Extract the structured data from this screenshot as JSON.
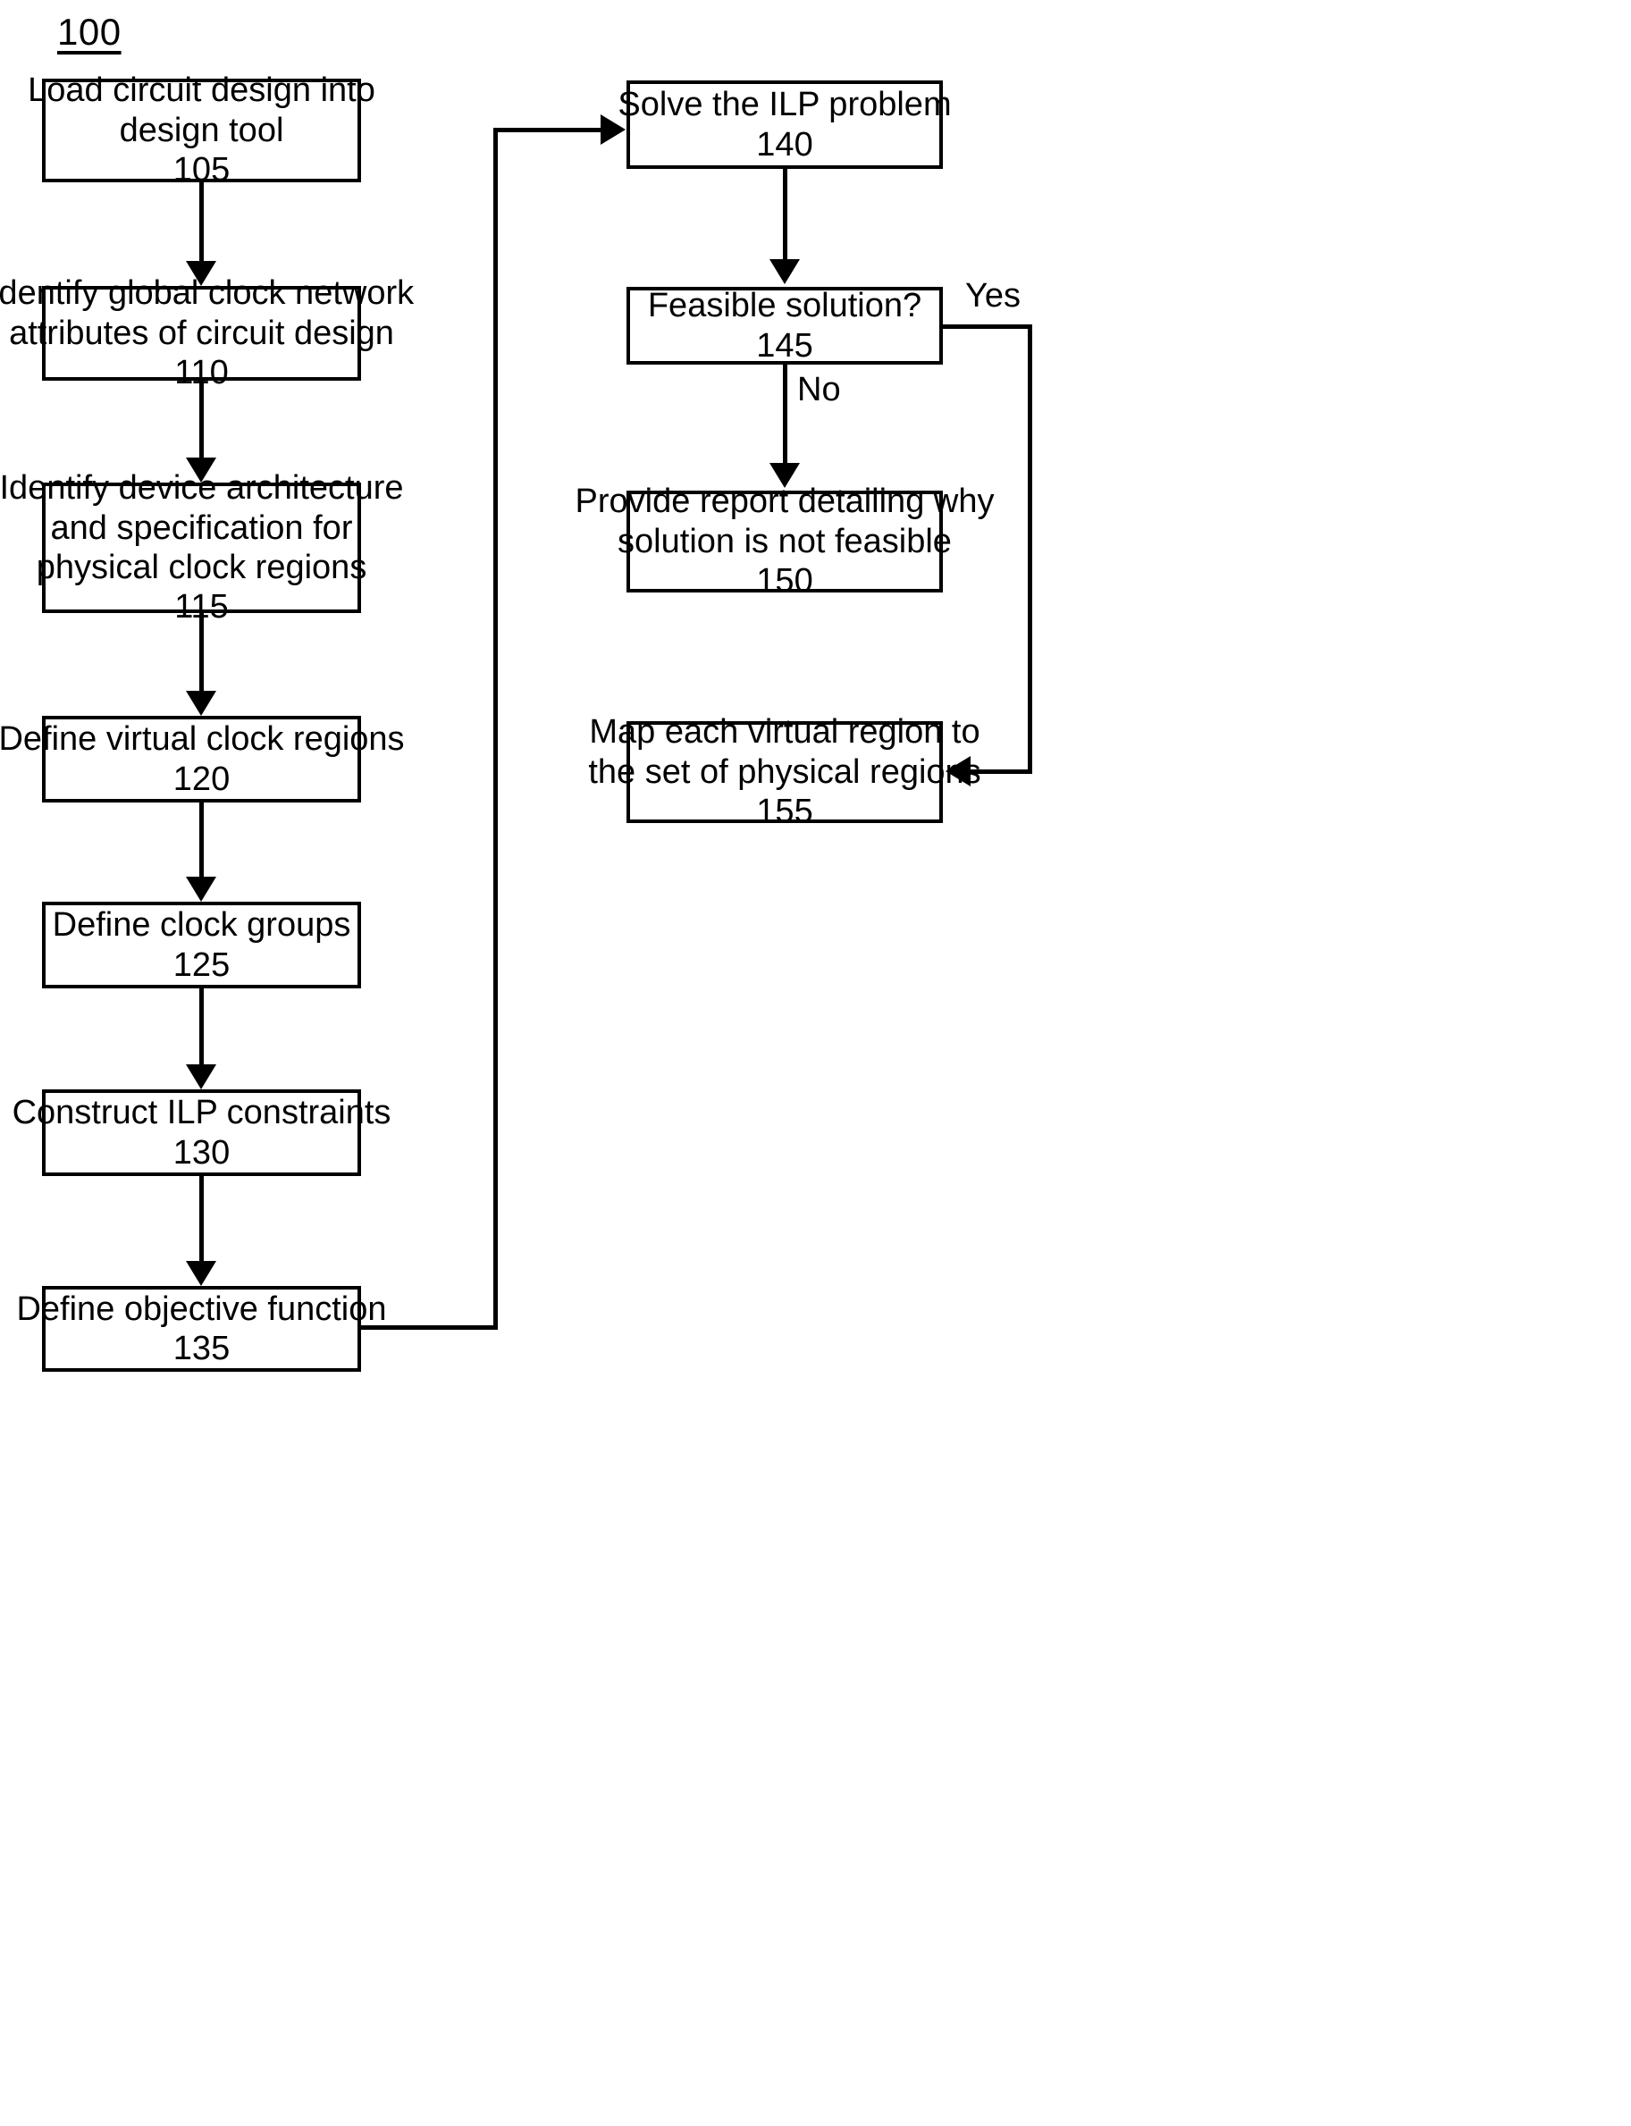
{
  "figure": {
    "number": "100"
  },
  "nodes": {
    "n105": {
      "text_lines": [
        "Load circuit design into",
        "design tool"
      ],
      "number": "105"
    },
    "n110": {
      "text_lines": [
        "Identify global clock network",
        "attributes of circuit design"
      ],
      "number": "110"
    },
    "n115": {
      "text_lines": [
        "Identify device architecture",
        "and specification for",
        "physical clock regions"
      ],
      "number": "115"
    },
    "n120": {
      "text_lines": [
        "Define virtual clock regions"
      ],
      "number": "120"
    },
    "n125": {
      "text_lines": [
        "Define clock groups"
      ],
      "number": "125"
    },
    "n130": {
      "text_lines": [
        "Construct ILP constraints"
      ],
      "number": "130"
    },
    "n135": {
      "text_lines": [
        "Define objective function"
      ],
      "number": "135"
    },
    "n140": {
      "text_lines": [
        "Solve the ILP problem"
      ],
      "number": "140"
    },
    "n145": {
      "text_lines": [
        "Feasible solution?"
      ],
      "number": "145"
    },
    "n150": {
      "text_lines": [
        "Provide report detailing why",
        "solution is not feasible"
      ],
      "number": "150"
    },
    "n155": {
      "text_lines": [
        "Map each virtual region to",
        "the set of physical regions"
      ],
      "number": "155"
    }
  },
  "edge_labels": {
    "yes": "Yes",
    "no": "No"
  },
  "colors": {
    "stroke": "#000000",
    "background": "#ffffff"
  }
}
